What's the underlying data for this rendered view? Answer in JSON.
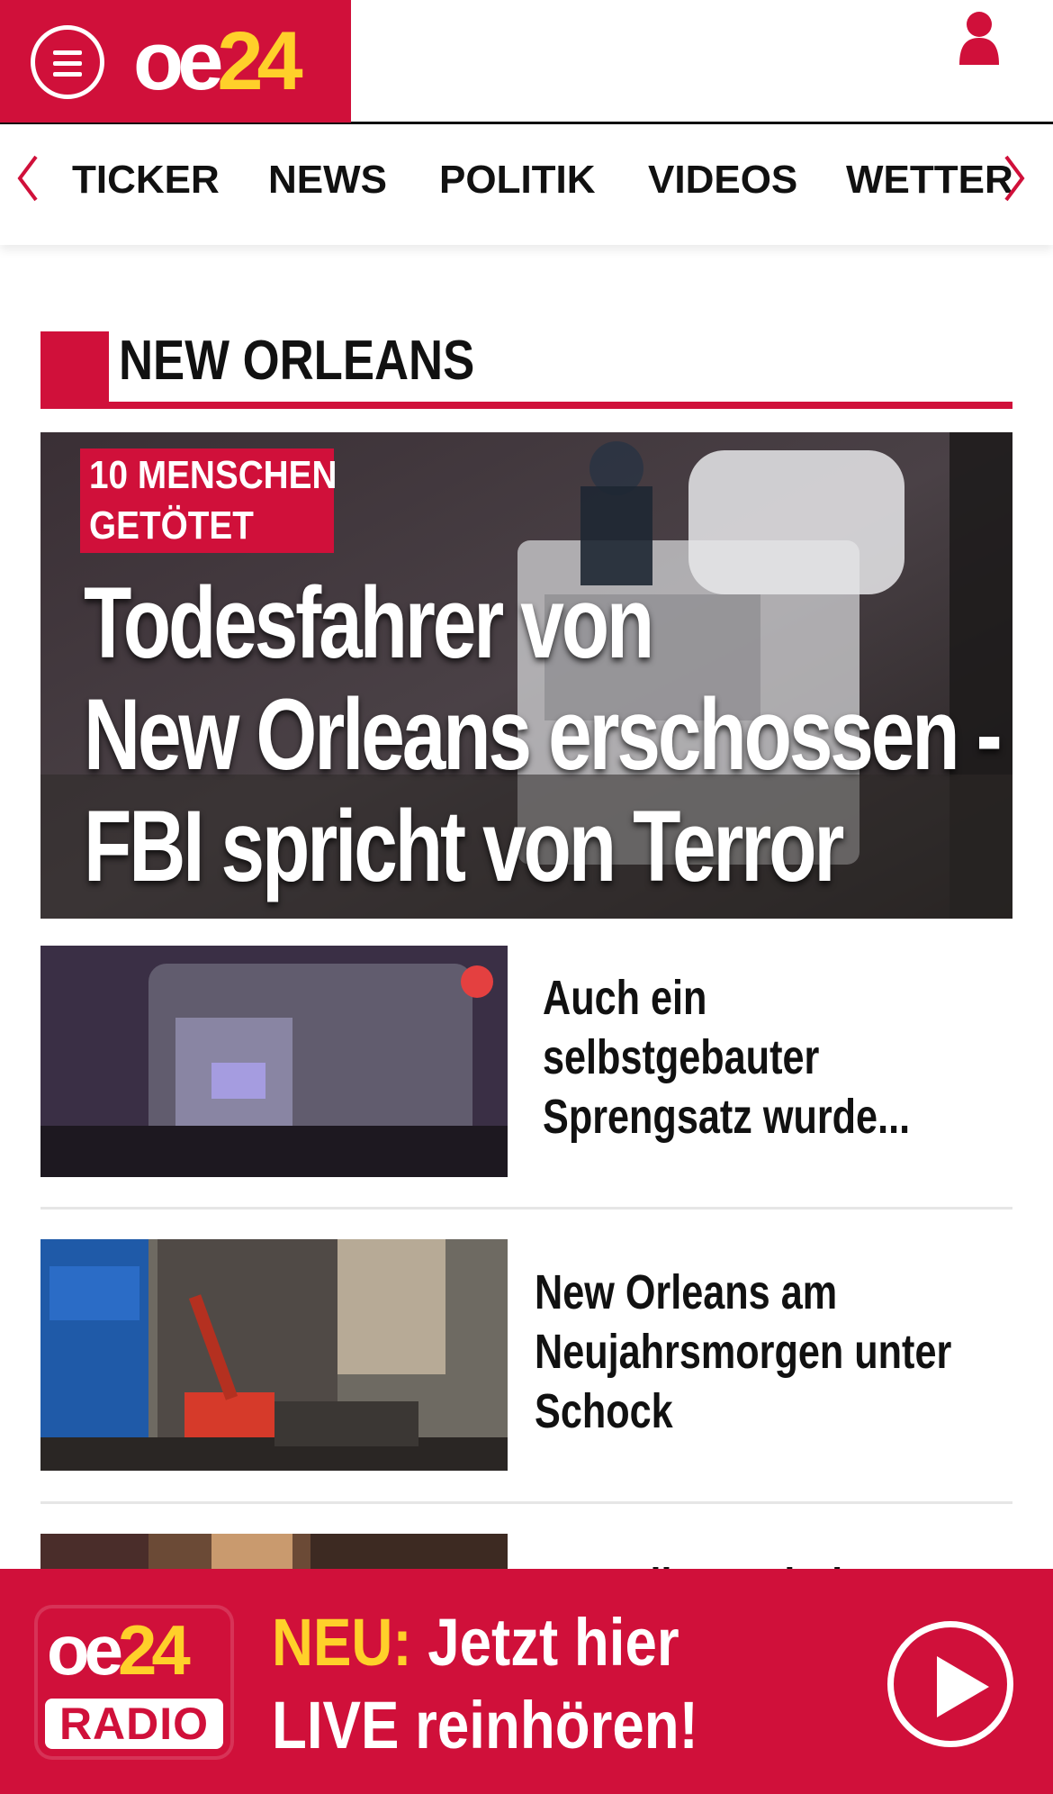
{
  "header": {
    "logo_oe": "oe",
    "logo_24": "24",
    "brand_color": "#d0103a",
    "accent_color": "#ffd02a",
    "menu_icon": "hamburger-menu-icon",
    "user_icon": "user-icon"
  },
  "nav": {
    "left_arrow_icon": "chevron-left-icon",
    "right_arrow_icon": "chevron-right-icon",
    "items": [
      "TICKER",
      "NEWS",
      "POLITIK",
      "VIDEOS",
      "WETTER"
    ]
  },
  "section": {
    "title": "NEW ORLEANS"
  },
  "hero": {
    "kicker_line1": "10 MENSCHEN",
    "kicker_line2": "GETÖTET",
    "title": "Todesfahrer von\nNew Orleans erschossen -\nFBI spricht von Terror"
  },
  "teasers": [
    {
      "title": "Auch ein\nselbstgebauter\nSprengsatz wurde..."
    },
    {
      "title": "New Orleans am\nNeujahrsmorgen unter\nSchock"
    },
    {
      "title": "\"Er sollte nach der"
    }
  ],
  "radio_banner": {
    "logo_oe": "oe",
    "logo_24": "24",
    "logo_radio": "RADIO",
    "neu_label": "NEU:",
    "line1_rest": " Jetzt hier",
    "line2": "LIVE reinhören!",
    "play_icon": "play-icon"
  }
}
